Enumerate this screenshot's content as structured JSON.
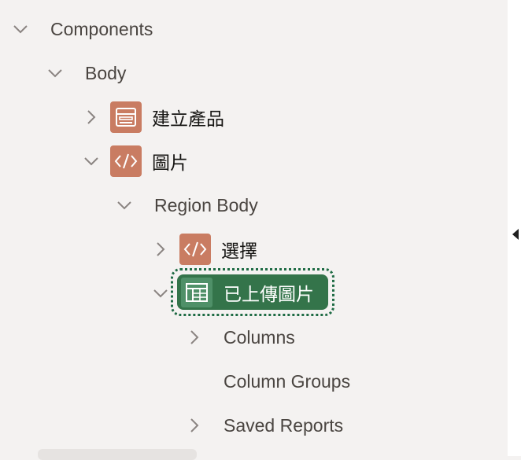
{
  "tree": {
    "components": {
      "label": "Components"
    },
    "body": {
      "label": "Body"
    },
    "create_product": {
      "label": "建立產品",
      "icon": "form-region-icon"
    },
    "image": {
      "label": "圖片",
      "icon": "code-region-icon"
    },
    "region_body": {
      "label": "Region Body"
    },
    "select": {
      "label": "選擇",
      "icon": "code-region-icon"
    },
    "uploaded_images": {
      "label": "已上傳圖片",
      "icon": "report-region-icon",
      "selected": true
    },
    "columns": {
      "label": "Columns"
    },
    "column_groups": {
      "label": "Column Groups"
    },
    "saved_reports": {
      "label": "Saved Reports"
    }
  },
  "colors": {
    "region_icon": "#c97c62",
    "selected_bg": "#34744a",
    "selected_icon": "#4f9068",
    "focus_ring": "#1e6b44"
  }
}
